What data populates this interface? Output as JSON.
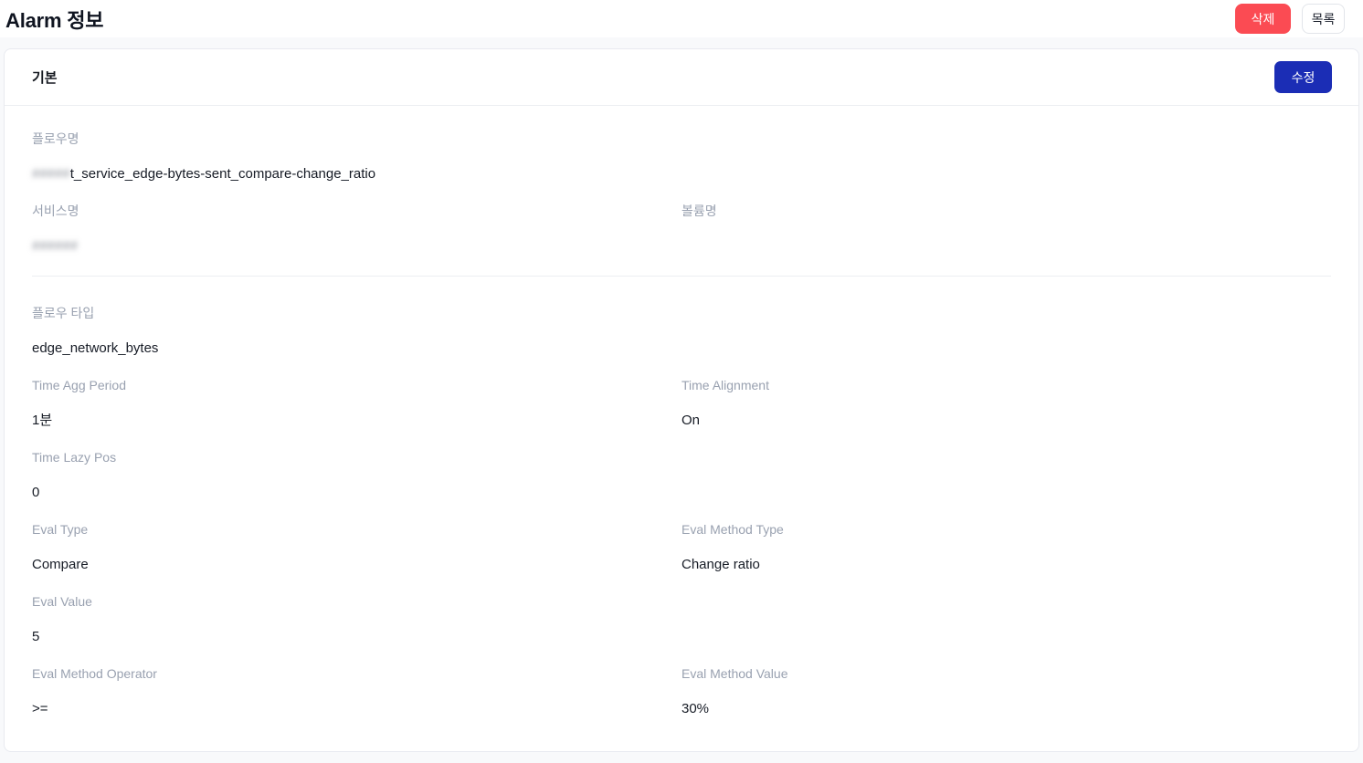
{
  "page": {
    "title": "Alarm 정보"
  },
  "top_actions": {
    "delete_label": "삭제",
    "list_label": "목록"
  },
  "card": {
    "title": "기본",
    "edit_label": "수정"
  },
  "fields": {
    "flow_name": {
      "label": "플로우명",
      "redacted_prefix": "#####",
      "value": "t_service_edge-bytes-sent_compare-change_ratio"
    },
    "service_name": {
      "label": "서비스명",
      "redacted_value": "######"
    },
    "volume_name": {
      "label": "볼륨명",
      "value": ""
    },
    "flow_type": {
      "label": "플로우 타입",
      "value": "edge_network_bytes"
    },
    "time_agg_period": {
      "label": "Time Agg Period",
      "value": "1분"
    },
    "time_alignment": {
      "label": "Time Alignment",
      "value": "On"
    },
    "time_lazy_pos": {
      "label": "Time Lazy Pos",
      "value": "0"
    },
    "eval_type": {
      "label": "Eval Type",
      "value": "Compare"
    },
    "eval_method_type": {
      "label": "Eval Method Type",
      "value": "Change ratio"
    },
    "eval_value": {
      "label": "Eval Value",
      "value": "5"
    },
    "eval_method_operator": {
      "label": "Eval Method Operator",
      "value": ">="
    },
    "eval_method_value": {
      "label": "Eval Method Value",
      "value": "30%"
    }
  },
  "colors": {
    "danger": "#fb4b53",
    "primary": "#1b2db5",
    "label_gray": "#99a1b0",
    "content_bg": "#f8f9fb",
    "card_border": "#e8eaf0"
  }
}
